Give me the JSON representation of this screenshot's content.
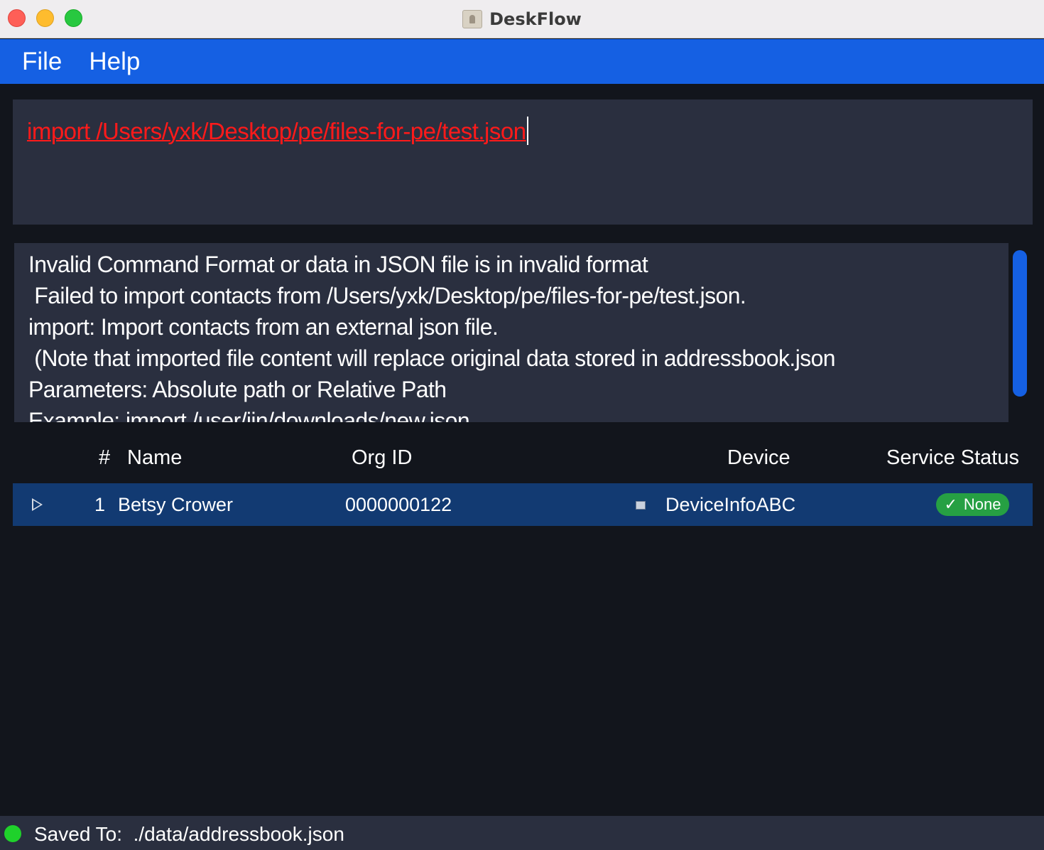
{
  "window": {
    "title": "DeskFlow",
    "controls": [
      "close",
      "minimize",
      "maximize"
    ]
  },
  "menu": {
    "items": [
      "File",
      "Help"
    ]
  },
  "command_box": {
    "value": "import /Users/yxk/Desktop/pe/files-for-pe/test.json",
    "text_color": "#ff1a1a"
  },
  "result_box": {
    "lines": [
      "Invalid Command Format or data in JSON file is in invalid format",
      " Failed to import contacts from /Users/yxk/Desktop/pe/files-for-pe/test.json.",
      "import: Import contacts from an external json file.",
      " (Note that imported file content will replace original data stored in addressbook.json",
      "Parameters: Absolute path or Relative Path",
      "Example: import /user/jin/downloads/new.json"
    ]
  },
  "table": {
    "headers": {
      "index": "#",
      "name": "Name",
      "org_id": "Org ID",
      "device": "Device",
      "service_status": "Service Status"
    },
    "rows": [
      {
        "index": "1",
        "name": "Betsy Crower",
        "org_id": "0000000122",
        "device_icon": "device-icon",
        "device": "DeviceInfoABC",
        "status_icon": "checkmark-icon",
        "status": "None"
      }
    ]
  },
  "status_bar": {
    "label": "Saved To:",
    "path": "./data/addressbook.json",
    "indicator_color": "#1fd12b"
  },
  "colors": {
    "accent": "#1560e3",
    "panel": "#2a2f3f",
    "background": "#12151c",
    "selected_row": "#123a72",
    "status_badge": "#26a043"
  }
}
